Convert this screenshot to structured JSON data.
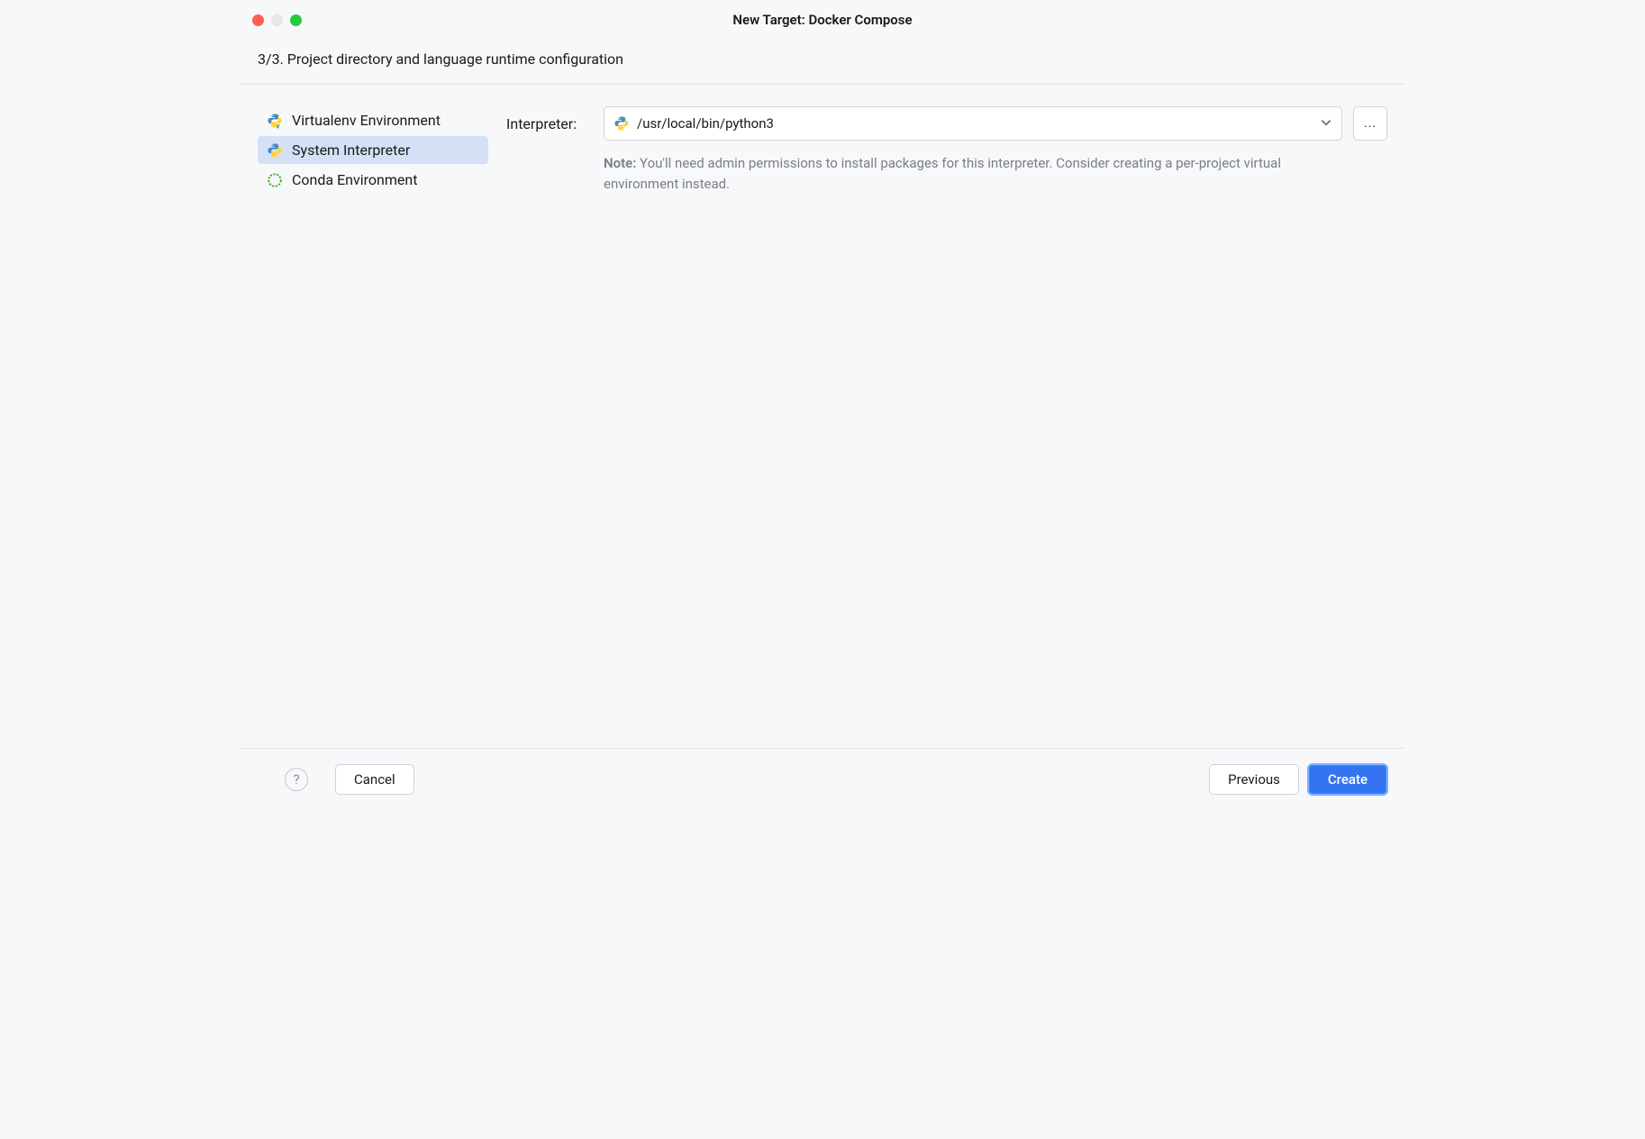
{
  "window": {
    "title": "New Target: Docker Compose"
  },
  "subtitle": "3/3. Project directory and language runtime configuration",
  "sidebar": {
    "items": [
      {
        "label": "Virtualenv Environment",
        "icon": "python-v-icon",
        "selected": false
      },
      {
        "label": "System Interpreter",
        "icon": "python-icon",
        "selected": true
      },
      {
        "label": "Conda Environment",
        "icon": "conda-icon",
        "selected": false
      }
    ]
  },
  "form": {
    "interpreter_label": "Interpreter:",
    "interpreter_value": "/usr/local/bin/python3",
    "ellipsis_label": "...",
    "note_label": "Note:",
    "note_text": "You'll need admin permissions to install packages for this interpreter. Consider creating a per-project virtual environment instead."
  },
  "footer": {
    "help_label": "?",
    "cancel_label": "Cancel",
    "previous_label": "Previous",
    "create_label": "Create"
  }
}
